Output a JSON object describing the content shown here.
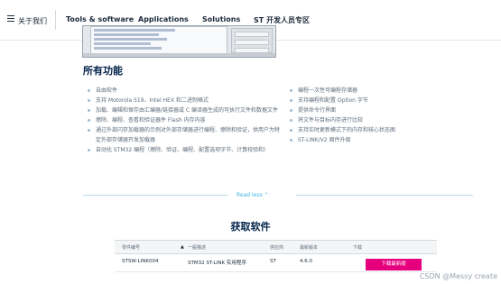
{
  "nav": {
    "about": "关于我们",
    "items": [
      "Tools & software",
      "Applications",
      "Solutions",
      "ST 开发人员专区"
    ]
  },
  "features": {
    "title": "所有功能",
    "left": [
      "自由软件",
      "支持 Motorola S19、Intel HEX 和二进制格式",
      "加载、编辑和保存由汇编器/链接器或 C 编译器生成的可执行文件和数据文件",
      "擦除、编程、查看和验证器件 Flash 内存内容",
      "通过外部闪存加载器的示例对外部存储器进行编程、擦除和验证，供用户为特定外部存储器开发加载器",
      "自动化 STM32 编程（擦除、验证、编程、配置选项字节、计算校验和）"
    ],
    "right": [
      "编程一次性可编程存储器",
      "支持编程和配置 Option 字节",
      "提供命令行界面",
      "将文件与目标内存进行比较",
      "支持实时更新模式下的内存和核心状态图",
      "ST-LINK/V2 固件升级"
    ]
  },
  "read_less": "Read less",
  "get_software": {
    "title": "获取软件",
    "headers": [
      "零件编号",
      "一般描述",
      "供应商",
      "最新版本",
      "下载"
    ],
    "row": [
      "STSW-LINK004",
      "STM32 ST-LINK 实用程序",
      "ST",
      "4.6.0"
    ],
    "download_label": "下载最新版"
  },
  "watermark": "CSDN @Messy create",
  "colors": {
    "accent_pink": "#e6007e",
    "link_blue": "#3cb4e6",
    "heading_navy": "#03234b"
  }
}
